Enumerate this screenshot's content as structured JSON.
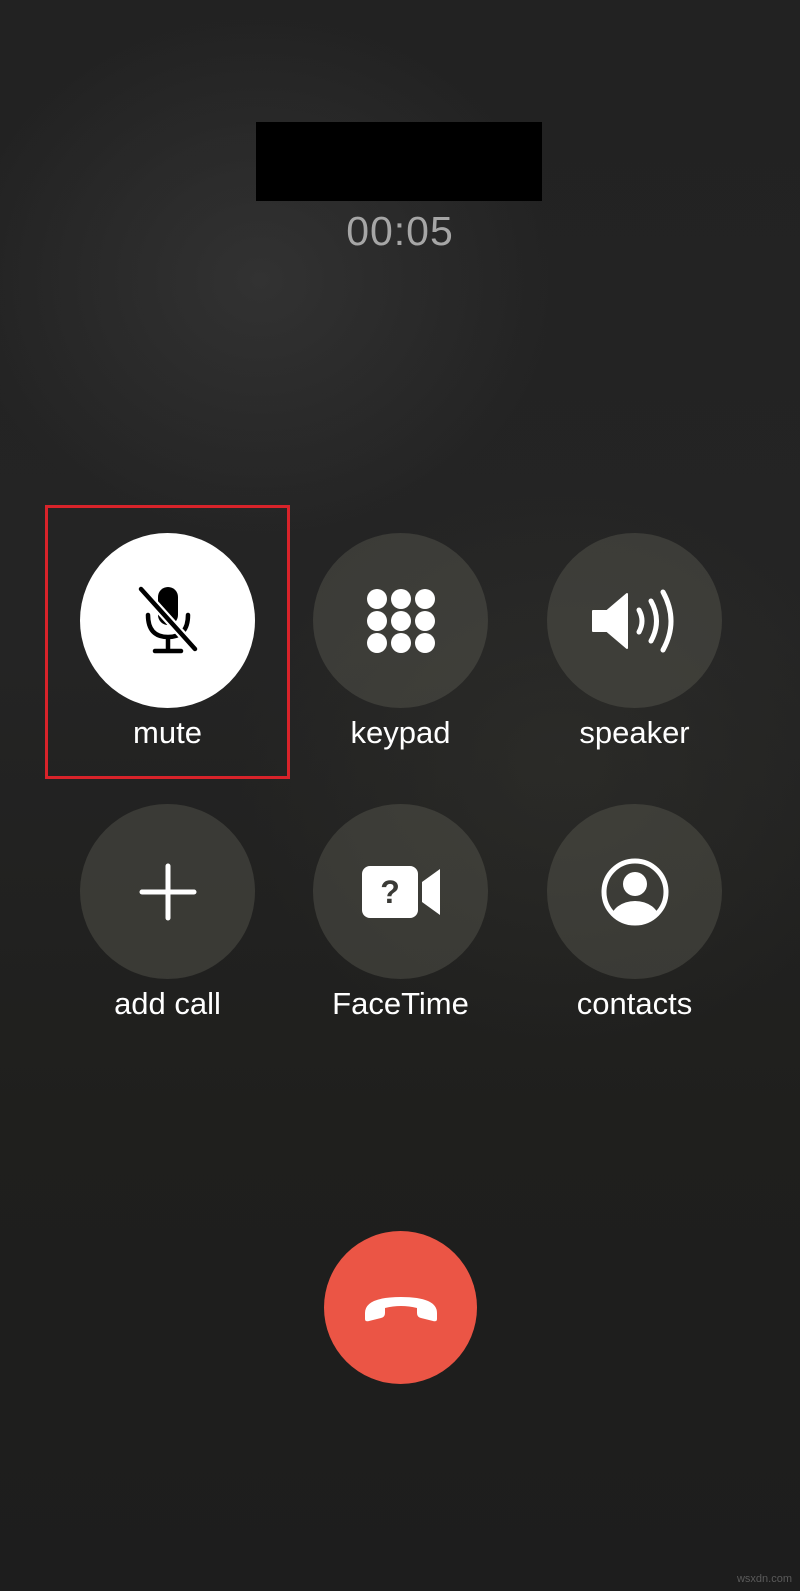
{
  "call": {
    "timer": "00:05",
    "status_accent": "#eb5545"
  },
  "controls": [
    {
      "id": "mute",
      "label": "mute",
      "icon": "microphone-slash-icon",
      "active": true,
      "highlighted": true
    },
    {
      "id": "keypad",
      "label": "keypad",
      "icon": "keypad-dots-icon",
      "active": false
    },
    {
      "id": "speaker",
      "label": "speaker",
      "icon": "speaker-wave-icon",
      "active": false
    },
    {
      "id": "add_call",
      "label": "add call",
      "icon": "plus-icon",
      "active": false
    },
    {
      "id": "facetime",
      "label": "FaceTime",
      "icon": "video-question-icon",
      "active": false
    },
    {
      "id": "contacts",
      "label": "contacts",
      "icon": "person-circle-icon",
      "active": false
    }
  ],
  "end_call": {
    "icon": "phone-hangup-icon",
    "color": "#eb5545"
  },
  "watermark": "wsxdn.com",
  "colors": {
    "highlight_border": "#d8232a",
    "active_button": "#ffffff"
  }
}
